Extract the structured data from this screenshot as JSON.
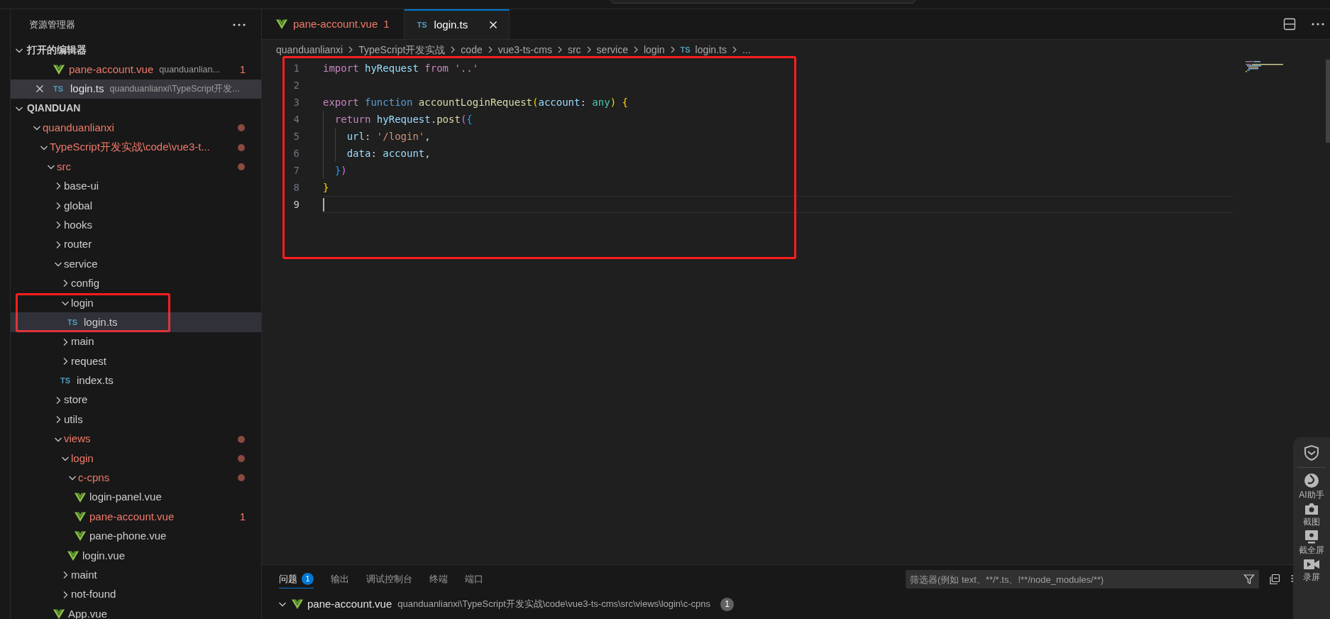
{
  "sidebar": {
    "title": "资源管理器",
    "open_editors": {
      "title": "打开的编辑器",
      "expanded": true,
      "items": [
        {
          "name": "pane-account.vue",
          "kind": "vue",
          "path": "quanduanlian...",
          "badge": "1",
          "error": true,
          "selected": false
        },
        {
          "name": "login.ts",
          "kind": "ts",
          "icon_text": "TS",
          "path": "quanduanlianxi\\TypeScript开发...",
          "error": false,
          "selected": true
        }
      ]
    },
    "workspace": {
      "title": "QIANDUAN",
      "expanded": true,
      "children": [
        {
          "label": "quanduanlianxi",
          "kind": "folder",
          "expanded": true,
          "error": true,
          "dot": true,
          "selected": false,
          "children": [
            {
              "label": "TypeScript开发实战\\code\\vue3-t...",
              "kind": "folder",
              "expanded": true,
              "error": true,
              "dot": true,
              "selected": false,
              "children": [
                {
                  "label": "src",
                  "kind": "folder",
                  "expanded": true,
                  "error": true,
                  "dot": true,
                  "selected": false,
                  "children": [
                    {
                      "label": "base-ui",
                      "kind": "folder",
                      "expanded": false,
                      "error": false,
                      "dot": false,
                      "selected": false
                    },
                    {
                      "label": "global",
                      "kind": "folder",
                      "expanded": false,
                      "error": false,
                      "dot": false,
                      "selected": false
                    },
                    {
                      "label": "hooks",
                      "kind": "folder",
                      "expanded": false,
                      "error": false,
                      "dot": false,
                      "selected": false
                    },
                    {
                      "label": "router",
                      "kind": "folder",
                      "expanded": false,
                      "error": false,
                      "dot": false,
                      "selected": false
                    },
                    {
                      "label": "service",
                      "kind": "folder",
                      "expanded": true,
                      "error": false,
                      "dot": false,
                      "selected": false,
                      "children": [
                        {
                          "label": "config",
                          "kind": "folder",
                          "expanded": false,
                          "error": false,
                          "dot": false,
                          "selected": false
                        },
                        {
                          "label": "login",
                          "kind": "folder",
                          "expanded": true,
                          "error": false,
                          "dot": false,
                          "selected": false,
                          "boxed": true,
                          "children": [
                            {
                              "label": "login.ts",
                              "kind": "ts",
                              "icon_text": "TS",
                              "error": false,
                              "dot": false,
                              "selected": true
                            }
                          ]
                        },
                        {
                          "label": "main",
                          "kind": "folder",
                          "expanded": false,
                          "error": false,
                          "dot": false,
                          "selected": false
                        },
                        {
                          "label": "request",
                          "kind": "folder",
                          "expanded": false,
                          "error": false,
                          "dot": false,
                          "selected": false
                        },
                        {
                          "label": "index.ts",
                          "kind": "ts",
                          "icon_text": "TS",
                          "error": false,
                          "dot": false,
                          "selected": false
                        }
                      ]
                    },
                    {
                      "label": "store",
                      "kind": "folder",
                      "expanded": false,
                      "error": false,
                      "dot": false,
                      "selected": false
                    },
                    {
                      "label": "utils",
                      "kind": "folder",
                      "expanded": false,
                      "error": false,
                      "dot": false,
                      "selected": false
                    },
                    {
                      "label": "views",
                      "kind": "folder",
                      "expanded": true,
                      "error": true,
                      "dot": true,
                      "selected": false,
                      "children": [
                        {
                          "label": "login",
                          "kind": "folder",
                          "expanded": true,
                          "error": true,
                          "dot": true,
                          "selected": false,
                          "children": [
                            {
                              "label": "c-cpns",
                              "kind": "folder",
                              "expanded": true,
                              "error": true,
                              "dot": true,
                              "selected": false,
                              "children": [
                                {
                                  "label": "login-panel.vue",
                                  "kind": "vue",
                                  "error": false,
                                  "dot": false,
                                  "selected": false
                                },
                                {
                                  "label": "pane-account.vue",
                                  "kind": "vue",
                                  "error": true,
                                  "dot": false,
                                  "badge": "1",
                                  "selected": false
                                },
                                {
                                  "label": "pane-phone.vue",
                                  "kind": "vue",
                                  "error": false,
                                  "dot": false,
                                  "selected": false
                                }
                              ]
                            },
                            {
                              "label": "login.vue",
                              "kind": "vue",
                              "error": false,
                              "dot": false,
                              "selected": false
                            }
                          ]
                        },
                        {
                          "label": "maint",
                          "kind": "folder",
                          "expanded": false,
                          "error": false,
                          "dot": false,
                          "selected": false
                        },
                        {
                          "label": "not-found",
                          "kind": "folder",
                          "expanded": false,
                          "error": false,
                          "dot": false,
                          "selected": false
                        }
                      ]
                    },
                    {
                      "label": "App.vue",
                      "kind": "vue",
                      "error": false,
                      "dot": false,
                      "selected": false
                    }
                  ]
                }
              ]
            }
          ]
        }
      ]
    }
  },
  "tabs": [
    {
      "label": "pane-account.vue",
      "kind": "vue",
      "badge": "1",
      "error": true,
      "selected": false
    },
    {
      "label": "login.ts",
      "kind": "ts",
      "icon_text": "TS",
      "error": false,
      "selected": true
    }
  ],
  "breadcrumb": [
    {
      "label": "quanduanlianxi"
    },
    {
      "label": "TypeScript开发实战"
    },
    {
      "label": "code"
    },
    {
      "label": "vue3-ts-cms"
    },
    {
      "label": "src"
    },
    {
      "label": "service"
    },
    {
      "label": "login"
    },
    {
      "label": "login.ts",
      "kind": "ts",
      "icon_text": "TS"
    },
    {
      "label": "..."
    }
  ],
  "editor": {
    "boxed": true,
    "lines": [
      {
        "number": "1",
        "active": false,
        "tokens": [
          {
            "text": "import",
            "kind": "keyword"
          },
          {
            "text": " hyRequest ",
            "kind": "variable"
          },
          {
            "text": "from",
            "kind": "keyword"
          },
          {
            "text": " '..'",
            "kind": "string"
          }
        ]
      },
      {
        "number": "2",
        "active": false
      },
      {
        "number": "3",
        "active": false,
        "tokens": [
          {
            "text": "export",
            "kind": "keyword"
          },
          {
            "text": " function",
            "kind": "storage"
          },
          {
            "text": " accountLoginRequest",
            "kind": "function"
          },
          {
            "text": "(",
            "kind": "bracket1"
          },
          {
            "text": "account",
            "kind": "variable"
          },
          {
            "text": ": ",
            "kind": "punct"
          },
          {
            "text": "any",
            "kind": "type"
          },
          {
            "text": ")",
            "kind": "bracket1"
          },
          {
            "text": " {",
            "kind": "bracket1"
          }
        ]
      },
      {
        "number": "4",
        "active": false,
        "tokens": [
          {
            "text": "  return",
            "kind": "keyword"
          },
          {
            "text": " hyRequest",
            "kind": "variable"
          },
          {
            "text": ".",
            "kind": "punct"
          },
          {
            "text": "post",
            "kind": "function"
          },
          {
            "text": "(",
            "kind": "bracket2"
          },
          {
            "text": "{",
            "kind": "bracket3"
          }
        ]
      },
      {
        "number": "5",
        "active": false,
        "tokens": [
          {
            "text": "    url",
            "kind": "variable"
          },
          {
            "text": ": ",
            "kind": "punct"
          },
          {
            "text": "'/login'",
            "kind": "string"
          },
          {
            "text": ",",
            "kind": "punct"
          }
        ]
      },
      {
        "number": "6",
        "active": false,
        "tokens": [
          {
            "text": "    data",
            "kind": "variable"
          },
          {
            "text": ": ",
            "kind": "punct"
          },
          {
            "text": "account",
            "kind": "variable"
          },
          {
            "text": ",",
            "kind": "punct"
          }
        ]
      },
      {
        "number": "7",
        "active": false,
        "tokens": [
          {
            "text": "  }",
            "kind": "bracket3"
          },
          {
            "text": ")",
            "kind": "bracket2"
          }
        ]
      },
      {
        "number": "8",
        "active": false,
        "tokens": [
          {
            "text": "}",
            "kind": "bracket1"
          }
        ]
      },
      {
        "number": "9",
        "active": true
      }
    ]
  },
  "panel": {
    "tabs": [
      {
        "label": "问题",
        "badge": "1",
        "selected": true
      },
      {
        "label": "输出",
        "selected": false
      },
      {
        "label": "调试控制台",
        "selected": false
      },
      {
        "label": "终端",
        "selected": false
      },
      {
        "label": "端口",
        "selected": false
      }
    ],
    "filter": {
      "placeholder": "筛选器(例如 text、**/*.ts、!**/node_modules/**)"
    },
    "problems": [
      {
        "file": "pane-account.vue",
        "kind": "vue",
        "path": "quanduanlianxi\\TypeScript开发实战\\code\\vue3-ts-cms\\src\\views\\login\\c-cpns",
        "count": "1",
        "expanded": true
      }
    ]
  },
  "floating_toolbar": {
    "items": [
      {
        "kind": "shield"
      },
      {
        "kind": "ai",
        "label": "AI助手"
      },
      {
        "kind": "camera",
        "label": "截图"
      },
      {
        "kind": "screen",
        "label": "截全屏"
      },
      {
        "kind": "video",
        "label": "录屏"
      }
    ]
  }
}
